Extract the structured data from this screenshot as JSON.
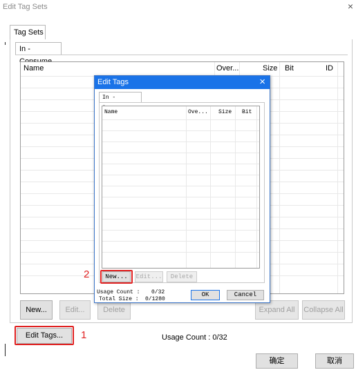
{
  "window": {
    "title": "Edit Tag Sets",
    "close": "×"
  },
  "outer_tab": "Tag Sets",
  "inner_tab": "In - Consume",
  "main_grid": {
    "columns": [
      "Name",
      "Over...",
      "Size",
      "Bit",
      "ID"
    ]
  },
  "main_buttons": {
    "new": "New...",
    "edit": "Edit...",
    "delete": "Delete",
    "expand_all": "Expand All",
    "collapse_all": "Collapse All",
    "edit_tags": "Edit Tags..."
  },
  "usage_count": "Usage Count : 0/32",
  "footer": {
    "ok": "确定",
    "cancel": "取消"
  },
  "callouts": {
    "one": "1",
    "two": "2"
  },
  "dialog": {
    "title": "Edit Tags",
    "close": "×",
    "tab": "In - Consume",
    "columns": [
      "Name",
      "Ove...",
      "Size",
      "Bit"
    ],
    "buttons": {
      "new": "New...",
      "edit": "Edit...",
      "delete": "Delete"
    },
    "usage_label": "Usage Count :",
    "usage_value": "0/32",
    "size_label": "Total Size :",
    "size_value": "0/1280",
    "ok": "OK",
    "cancel": "Cancel"
  }
}
